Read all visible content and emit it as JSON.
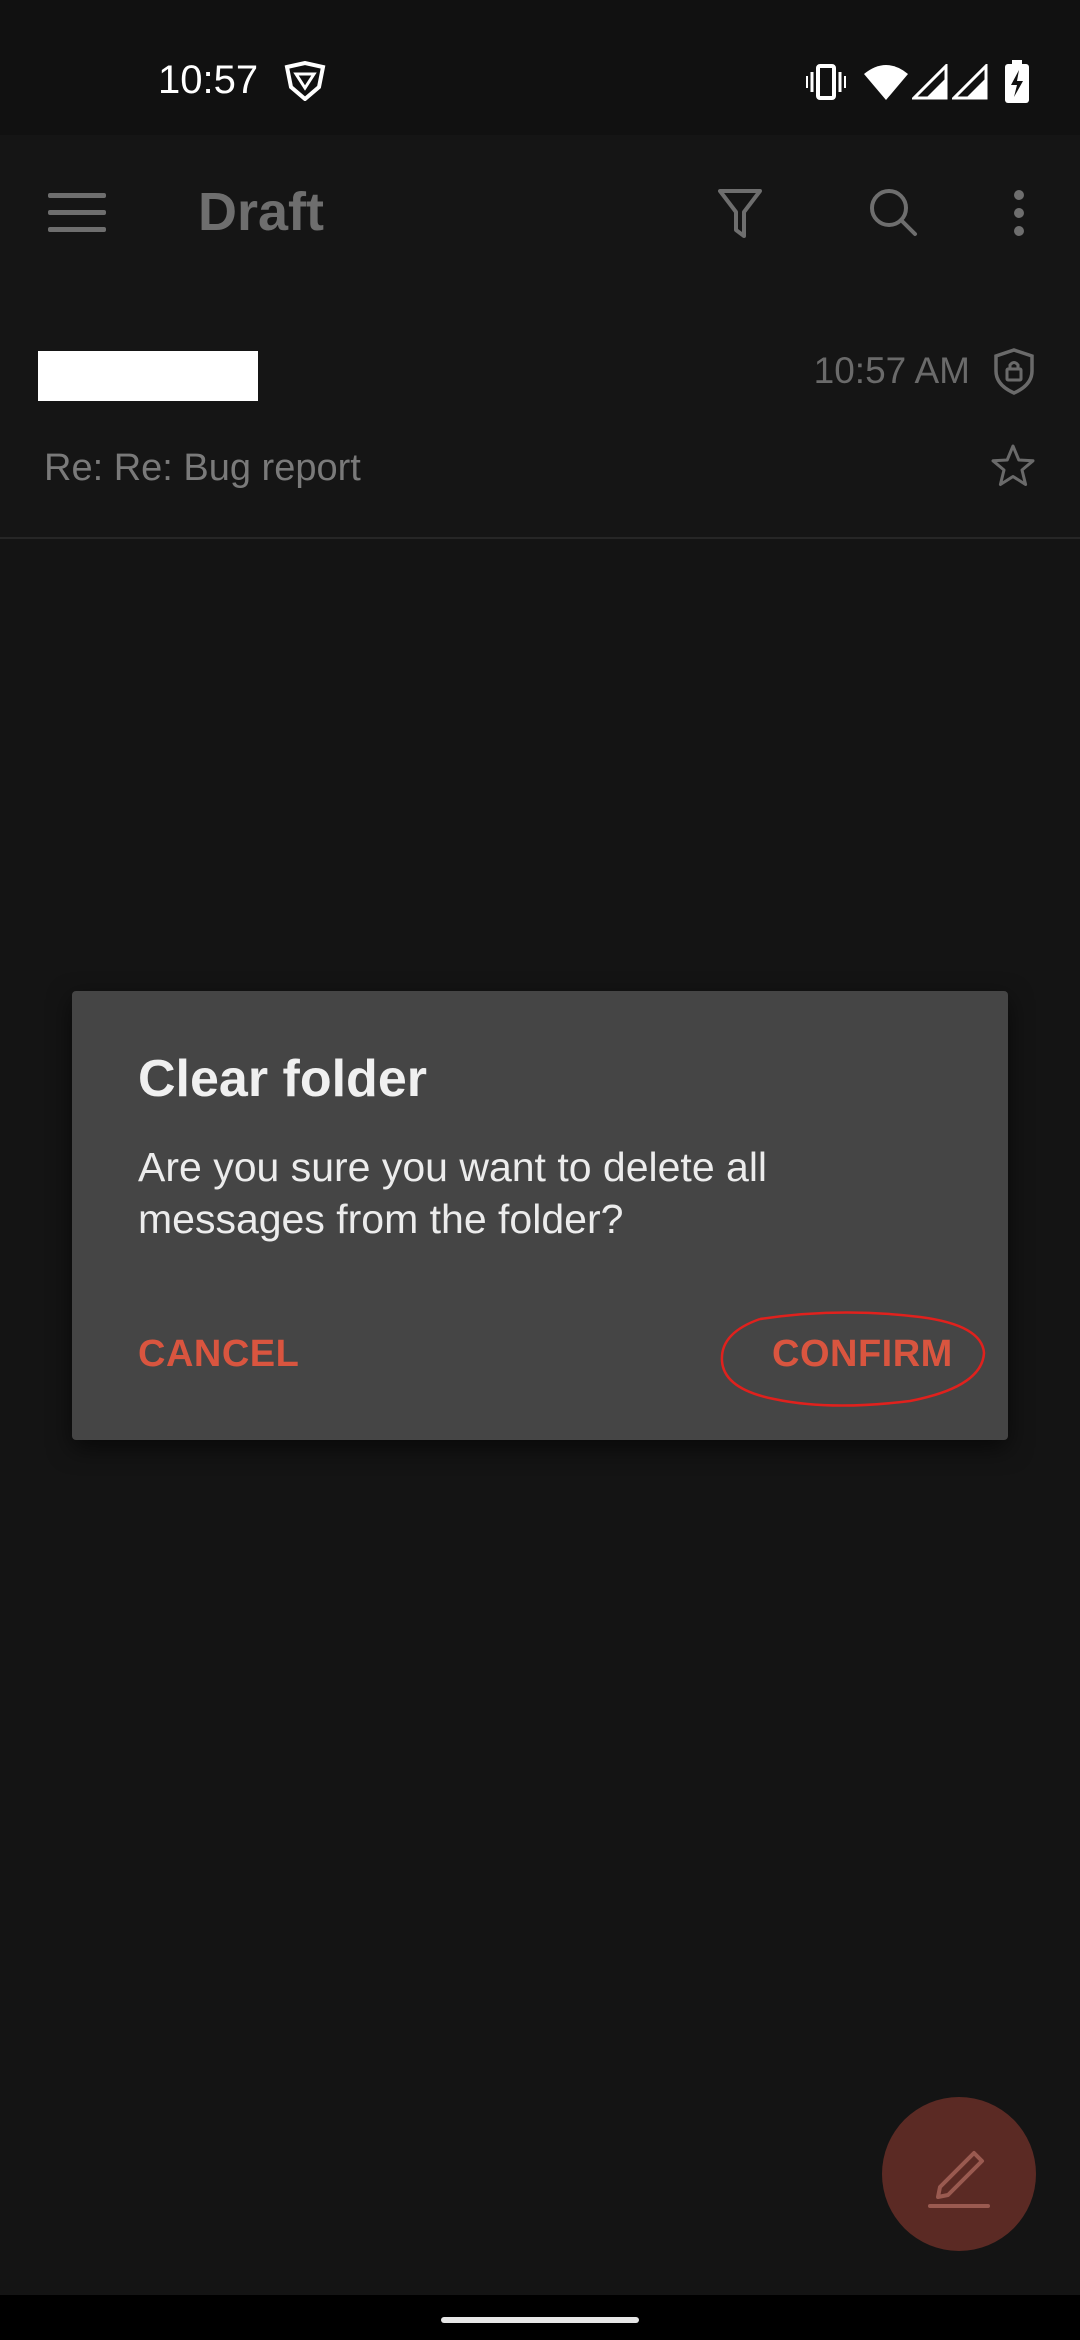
{
  "status_bar": {
    "time": "10:57",
    "icons": [
      "shield-vpn-icon",
      "vibrate-icon",
      "wifi-icon",
      "signal-icon",
      "signal-icon",
      "battery-charging-icon"
    ]
  },
  "app_bar": {
    "title": "Draft",
    "icons": [
      "menu-icon",
      "filter-icon",
      "search-icon",
      "more-vert-icon"
    ]
  },
  "message": {
    "sender": "",
    "time": "10:57 AM",
    "subject": "Re: Re: Bug report",
    "icons": [
      "encrypted-shield-icon",
      "star-icon"
    ]
  },
  "dialog": {
    "title": "Clear folder",
    "message": "Are you sure you want to delete all messages from the folder?",
    "cancel_label": "CANCEL",
    "confirm_label": "CONFIRM"
  },
  "fab": {
    "icon": "compose-pencil-icon"
  },
  "colors": {
    "background": "#141414",
    "accent": "#d9553f",
    "dialog_bg": "#454545",
    "fab_bg": "#5b2a24",
    "annotation": "#e0211d"
  }
}
